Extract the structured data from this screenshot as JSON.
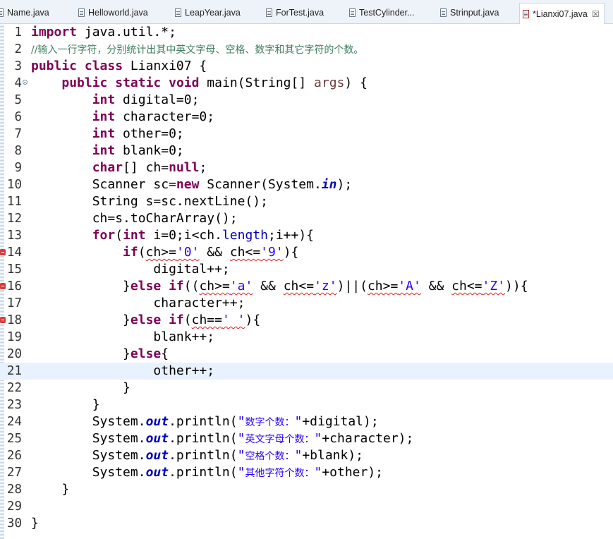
{
  "tabs": [
    {
      "label": "Name.java",
      "active": false
    },
    {
      "label": "Helloworld.java",
      "active": false
    },
    {
      "label": "LeapYear.java",
      "active": false
    },
    {
      "label": "ForTest.java",
      "active": false
    },
    {
      "label": "TestCylinder...",
      "active": false
    },
    {
      "label": "Strinput.java",
      "active": false
    },
    {
      "label": "*Lianxi07.java",
      "active": true
    }
  ],
  "close_glyph": "☒",
  "current_line": 21,
  "error_lines": [
    14,
    16,
    18
  ],
  "lines": [
    {
      "n": "1",
      "text": "import java.util.*;"
    },
    {
      "n": "2",
      "text": "//输入一行字符，分别统计出其中英文字母、空格、数字和其它字符的个数。"
    },
    {
      "n": "3",
      "text": "public class Lianxi07 {"
    },
    {
      "n": "4",
      "text": "    public static void main(String[] args) {"
    },
    {
      "n": "5",
      "text": "        int digital=0;"
    },
    {
      "n": "6",
      "text": "        int character=0;"
    },
    {
      "n": "7",
      "text": "        int other=0;"
    },
    {
      "n": "8",
      "text": "        int blank=0;"
    },
    {
      "n": "9",
      "text": "        char[] ch=null;"
    },
    {
      "n": "10",
      "text": "        Scanner sc=new Scanner(System.in);"
    },
    {
      "n": "11",
      "text": "        String s=sc.nextLine();"
    },
    {
      "n": "12",
      "text": "        ch=s.toCharArray();"
    },
    {
      "n": "13",
      "text": "        for(int i=0;i<ch.length;i++){"
    },
    {
      "n": "14",
      "text": "            if(ch>='0' && ch<='9'){"
    },
    {
      "n": "15",
      "text": "                digital++;"
    },
    {
      "n": "16",
      "text": "            }else if((ch>='a' && ch<='z')||(ch>='A' && ch<='Z')){"
    },
    {
      "n": "17",
      "text": "                character++;"
    },
    {
      "n": "18",
      "text": "            }else if(ch==' '){"
    },
    {
      "n": "19",
      "text": "                blank++;"
    },
    {
      "n": "20",
      "text": "            }else{"
    },
    {
      "n": "21",
      "text": "                other++;"
    },
    {
      "n": "22",
      "text": "            }"
    },
    {
      "n": "23",
      "text": "        }"
    },
    {
      "n": "24",
      "text": "        System.out.println(\"数字个数：\"+digital);"
    },
    {
      "n": "25",
      "text": "        System.out.println(\"英文字母个数：\"+character);"
    },
    {
      "n": "26",
      "text": "        System.out.println(\"空格个数：\"+blank);"
    },
    {
      "n": "27",
      "text": "        System.out.println(\"其他字符个数：\"+other);"
    },
    {
      "n": "28",
      "text": "    }"
    },
    {
      "n": "29",
      "text": ""
    },
    {
      "n": "30",
      "text": "}"
    }
  ]
}
